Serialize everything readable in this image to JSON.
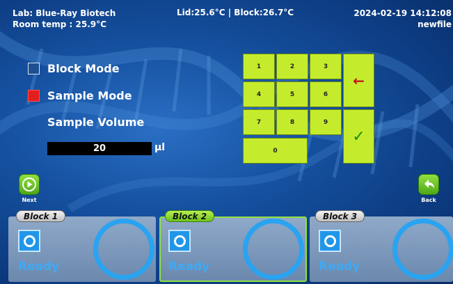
{
  "header": {
    "lab": "Lab: Blue-Ray Biotech",
    "room_temp": "Room temp : 25.9°C",
    "temps": "Lid:25.6°C | Block:26.7°C",
    "datetime": "2024-02-19 14:12:08",
    "filename": "newfile"
  },
  "modes": {
    "block_mode": {
      "label": "Block Mode",
      "checked": false
    },
    "sample_mode": {
      "label": "Sample Mode",
      "checked": true
    }
  },
  "sample_volume": {
    "label": "Sample Volume",
    "value": "20",
    "unit": "µl"
  },
  "keypad": {
    "keys": [
      "1",
      "2",
      "3",
      "4",
      "5",
      "6",
      "7",
      "8",
      "9",
      "0"
    ],
    "backspace_icon": "left-arrow-icon",
    "confirm_icon": "check-icon"
  },
  "nav": {
    "next_label": "Next",
    "back_label": "Back",
    "next_icon": "play-icon",
    "back_icon": "undo-arrow-icon"
  },
  "blocks": [
    {
      "name": "Block 1",
      "status": "Ready",
      "active": false
    },
    {
      "name": "Block 2",
      "status": "Ready",
      "active": true
    },
    {
      "name": "Block 3",
      "status": "Ready",
      "active": false
    }
  ],
  "colors": {
    "background": "#15509f",
    "key_yellow_green": "#c5ec2c",
    "active_green": "#8fe040",
    "ready_blue": "#3fa9f5",
    "checked_red": "#e31e1e"
  }
}
